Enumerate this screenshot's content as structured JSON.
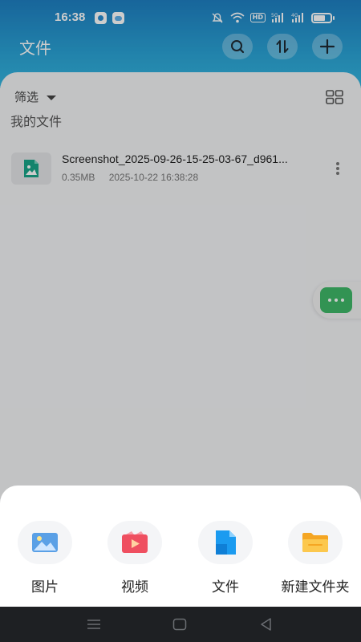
{
  "status_bar": {
    "time": "16:38",
    "hd_label": "HD",
    "signal_1": "5G",
    "signal_2": "4G"
  },
  "header": {
    "title": "文件",
    "search_icon": "search-icon",
    "sort_icon": "sort-icon",
    "add_icon": "plus-icon"
  },
  "content": {
    "filter_label": "筛选",
    "section_title": "我的文件",
    "files": [
      {
        "name": "Screenshot_2025-09-26-15-25-03-67_d961...",
        "size": "0.35MB",
        "date": "2025-10-22 16:38:28"
      }
    ]
  },
  "sheet": {
    "items": [
      {
        "label": "图片",
        "icon": "image-icon"
      },
      {
        "label": "视频",
        "icon": "video-icon"
      },
      {
        "label": "文件",
        "icon": "file-icon"
      },
      {
        "label": "新建文件夹",
        "icon": "new-folder-icon"
      }
    ]
  },
  "colors": {
    "header_top": "#1e7fc2",
    "header_bottom": "#35b7e0",
    "assist_green": "#3fb868"
  }
}
